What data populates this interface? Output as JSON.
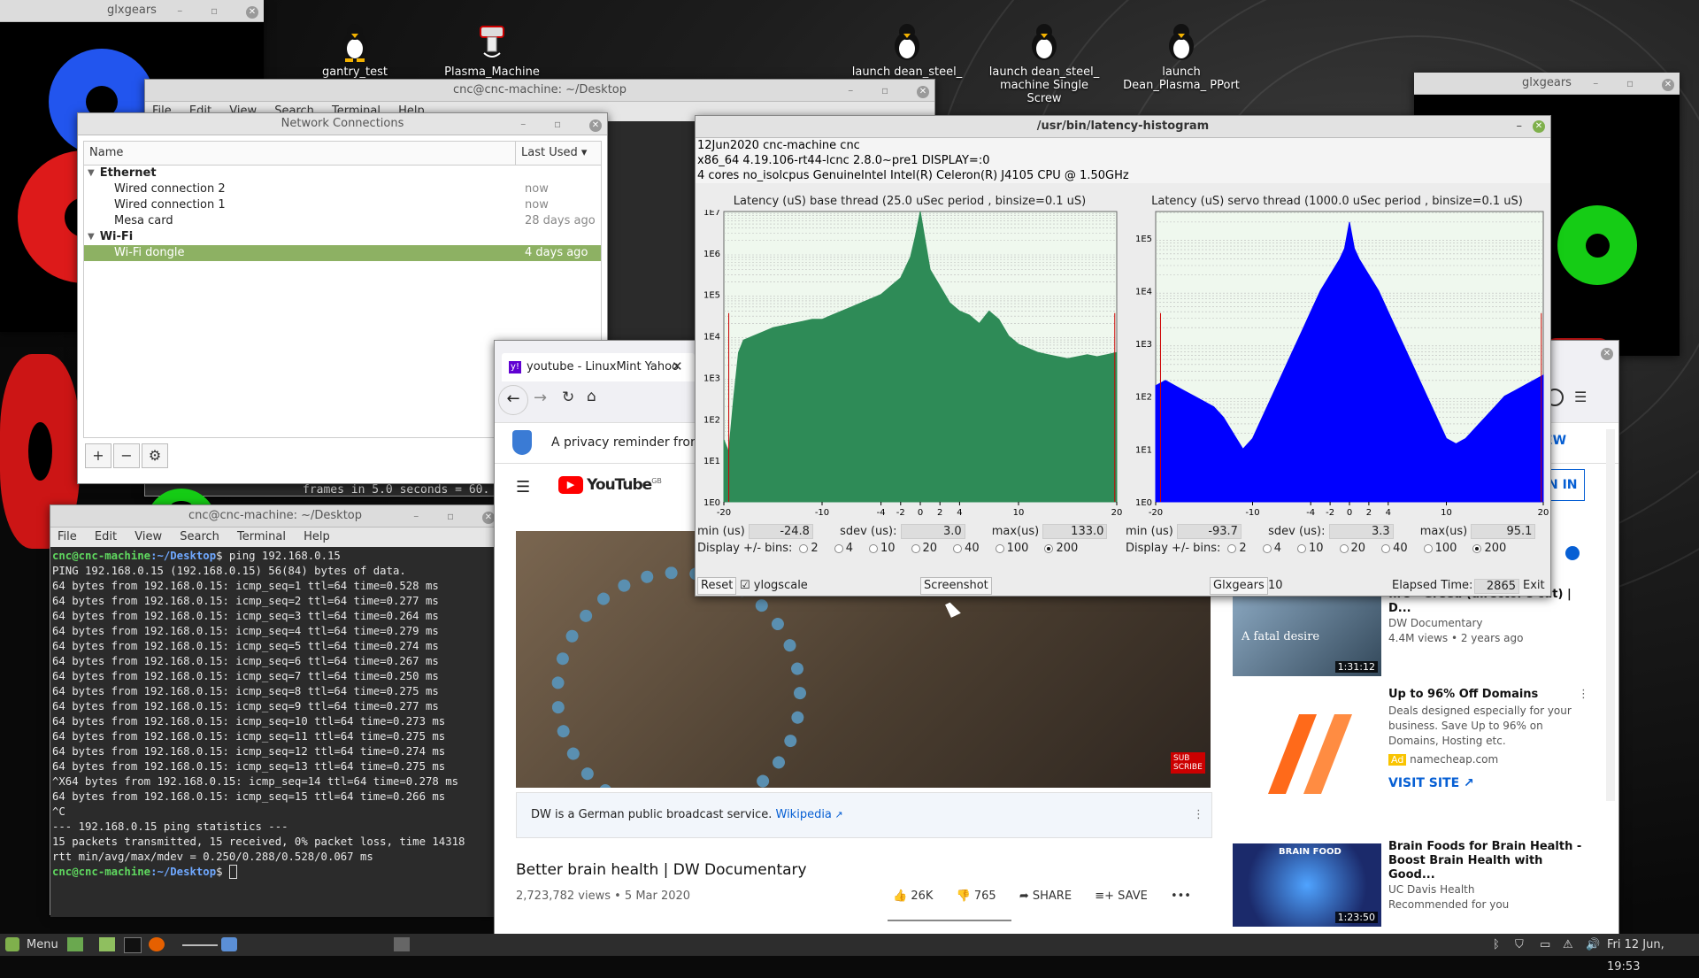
{
  "desktop": {
    "icons": [
      {
        "label": "gantry_test"
      },
      {
        "label": "Plasma_Machine"
      },
      {
        "label": "launch dean_steel_ ... are"
      },
      {
        "label": "launch dean_steel_ machine Single Screw"
      },
      {
        "label": "launch Dean_Plasma_ PPort"
      }
    ]
  },
  "glxgears_left": {
    "title": "glxgears"
  },
  "glxgears_right": {
    "title": "glxgears"
  },
  "back_terminal": {
    "title": "cnc@cnc-machine: ~/Desktop",
    "menu": [
      "File",
      "Edit",
      "View",
      "Search",
      "Terminal",
      "Help"
    ],
    "frames_line": "frames in 5.0 seconds = 60."
  },
  "network": {
    "title": "Network Connections",
    "col_name": "Name",
    "col_used": "Last Used",
    "groups": [
      {
        "name": "Ethernet",
        "items": [
          {
            "name": "Wired connection 2",
            "used": "now"
          },
          {
            "name": "Wired connection 1",
            "used": "now"
          },
          {
            "name": "Mesa card",
            "used": "28 days ago"
          }
        ]
      },
      {
        "name": "Wi-Fi",
        "items": [
          {
            "name": "Wi-Fi dongle",
            "used": "4 days ago"
          }
        ]
      }
    ],
    "buttons": [
      "+",
      "−",
      "⚙"
    ]
  },
  "terminal": {
    "title": "cnc@cnc-machine: ~/Desktop",
    "menu": [
      "File",
      "Edit",
      "View",
      "Search",
      "Terminal",
      "Help"
    ],
    "prompt_user": "cnc@cnc-machine",
    "prompt_path": ":~/Desktop",
    "command": "$ ping 192.168.0.15",
    "lines": [
      "PING 192.168.0.15 (192.168.0.15) 56(84) bytes of data.",
      "64 bytes from 192.168.0.15: icmp_seq=1 ttl=64 time=0.528 ms",
      "64 bytes from 192.168.0.15: icmp_seq=2 ttl=64 time=0.277 ms",
      "64 bytes from 192.168.0.15: icmp_seq=3 ttl=64 time=0.264 ms",
      "64 bytes from 192.168.0.15: icmp_seq=4 ttl=64 time=0.279 ms",
      "64 bytes from 192.168.0.15: icmp_seq=5 ttl=64 time=0.274 ms",
      "64 bytes from 192.168.0.15: icmp_seq=6 ttl=64 time=0.267 ms",
      "64 bytes from 192.168.0.15: icmp_seq=7 ttl=64 time=0.250 ms",
      "64 bytes from 192.168.0.15: icmp_seq=8 ttl=64 time=0.275 ms",
      "64 bytes from 192.168.0.15: icmp_seq=9 ttl=64 time=0.277 ms",
      "64 bytes from 192.168.0.15: icmp_seq=10 ttl=64 time=0.273 ms",
      "64 bytes from 192.168.0.15: icmp_seq=11 ttl=64 time=0.275 ms",
      "64 bytes from 192.168.0.15: icmp_seq=12 ttl=64 time=0.274 ms",
      "64 bytes from 192.168.0.15: icmp_seq=13 ttl=64 time=0.275 ms",
      "^X64 bytes from 192.168.0.15: icmp_seq=14 ttl=64 time=0.278 ms",
      "64 bytes from 192.168.0.15: icmp_seq=15 ttl=64 time=0.266 ms",
      "^C",
      "--- 192.168.0.15 ping statistics ---",
      "15 packets transmitted, 15 received, 0% packet loss, time 14318",
      "rtt min/avg/max/mdev = 0.250/0.288/0.528/0.067 ms"
    ],
    "final_prompt_suffix": "$ "
  },
  "latency": {
    "title": "/usr/bin/latency-histogram",
    "info1": "12Jun2020 cnc-machine cnc",
    "info2": " x86_64  4.19.106-rt44-lcnc  2.8.0~pre1  DISPLAY=:0",
    "info3": " 4 cores  no_isolcpus   GenuineIntel  Intel(R) Celeron(R) J4105 CPU @ 1.50GHz",
    "base": {
      "title": "Latency (uS) base thread (25.0 uSec period , binsize=0.1 uS)",
      "min_label": "min (us)",
      "min": "-24.8",
      "sdev_label": "sdev (us):",
      "sdev": "3.0",
      "max_label": "max(us)",
      "max": "133.0"
    },
    "servo": {
      "title": "Latency (uS) servo thread (1000.0 uSec period , binsize=0.1 uS)",
      "min_label": "min (us)",
      "min": "-93.7",
      "sdev_label": "sdev (us):",
      "sdev": "3.3",
      "max_label": "max(us)",
      "max": "95.1"
    },
    "display_label": "Display +/- bins:",
    "bin_options": [
      "2",
      "4",
      "10",
      "20",
      "40",
      "100",
      "200"
    ],
    "bin_selected": "200",
    "reset": "Reset",
    "ylogscale": "ylogscale",
    "screenshot": "Screenshot",
    "glxgears": "Glxgears",
    "glx_count": "10",
    "elapsed_label": "Elapsed Time:",
    "elapsed": "2865",
    "exit": "Exit"
  },
  "chart_data": [
    {
      "type": "area",
      "title": "Latency (uS) base thread (25.0 uSec period , binsize=0.1 uS)",
      "x_ticks": [
        "-20",
        "-10",
        "-4",
        "-2",
        "0",
        "2",
        "4",
        "10",
        "20"
      ],
      "y_ticks": [
        "1E0",
        "1E1",
        "1E2",
        "1E3",
        "1E4",
        "1E5",
        "1E6",
        "1E7"
      ],
      "ylog": true,
      "xlim": [
        -20,
        20
      ],
      "ylim_exp": [
        0,
        7
      ],
      "color": "#2e8b57",
      "x": [
        -20,
        -19.5,
        -19,
        -18.5,
        -18,
        -17,
        -16,
        -15,
        -14,
        -13,
        -12,
        -11,
        -10,
        -9,
        -8,
        -7,
        -6,
        -5,
        -4,
        -3,
        -2,
        -1,
        -0.5,
        0,
        0.5,
        1,
        2,
        3,
        4,
        5,
        6,
        7,
        8,
        9,
        10,
        11,
        12,
        13,
        14,
        15,
        16,
        17,
        18,
        19,
        20
      ],
      "y_exp": [
        1.5,
        1.2,
        2.5,
        3.6,
        3.9,
        4.0,
        4.1,
        4.2,
        4.25,
        4.3,
        4.35,
        4.4,
        4.4,
        4.5,
        4.6,
        4.7,
        4.8,
        4.9,
        5.0,
        5.2,
        5.4,
        5.9,
        6.4,
        7.0,
        6.3,
        5.6,
        5.2,
        4.8,
        4.6,
        4.5,
        4.3,
        4.6,
        4.4,
        4.0,
        3.8,
        3.7,
        3.6,
        3.55,
        3.5,
        3.45,
        3.5,
        3.55,
        3.5,
        3.55,
        3.6
      ]
    },
    {
      "type": "area",
      "title": "Latency (uS) servo thread (1000.0 uSec period , binsize=0.1 uS)",
      "x_ticks": [
        "-20",
        "-10",
        "-4",
        "-2",
        "0",
        "2",
        "4",
        "10",
        "20"
      ],
      "y_ticks": [
        "1E0",
        "1E1",
        "1E2",
        "1E3",
        "1E4",
        "1E5"
      ],
      "ylog": true,
      "xlim": [
        -20,
        20
      ],
      "ylim_exp": [
        0,
        5.5
      ],
      "color": "#0000ff",
      "x": [
        -20,
        -19,
        -18,
        -17,
        -16,
        -15,
        -14,
        -13,
        -12,
        -11,
        -10,
        -9,
        -8,
        -7,
        -6,
        -5,
        -4,
        -3,
        -2,
        -1,
        -0.5,
        0,
        0.5,
        1,
        2,
        3,
        4,
        5,
        6,
        7,
        8,
        9,
        10,
        11,
        12,
        13,
        14,
        15,
        16,
        17,
        18,
        19,
        20
      ],
      "y_exp": [
        2.2,
        2.3,
        2.2,
        2.1,
        2.0,
        1.9,
        1.8,
        1.6,
        1.3,
        1.0,
        1.2,
        1.6,
        2.0,
        2.4,
        2.8,
        3.2,
        3.6,
        4.0,
        4.3,
        4.6,
        4.8,
        5.3,
        4.8,
        4.6,
        4.3,
        4.0,
        3.6,
        3.2,
        2.8,
        2.4,
        2.0,
        1.6,
        1.2,
        1.1,
        1.2,
        1.4,
        1.6,
        1.8,
        2.0,
        2.1,
        2.2,
        2.3,
        2.4
      ]
    }
  ],
  "browser": {
    "tab_title": "youtube - LinuxMint Yahoo",
    "privacy_text": "A privacy reminder from Y",
    "yt_logo": "YouTube",
    "yt_region": "GB",
    "view_btn": "VIEW",
    "signin_btn": "GN IN",
    "subscribe_badge": "SUB\nSCRIBE",
    "info_text": "DW is a German public broadcast service.",
    "info_link": "Wikipedia",
    "video_title": "Better brain health | DW Documentary",
    "video_meta": "2,723,782 views • 5 Mar 2020",
    "likes": "26K",
    "dislikes": "765",
    "share": "SHARE",
    "save": "SAVE",
    "side": [
      {
        "title": "fire - Greed (director's cut) | D...",
        "channel": "DW Documentary",
        "meta": "4.4M views • 2 years ago",
        "thumb_text": "A fatal desire",
        "duration": "1:31:12"
      },
      {
        "title": "Up to 96% Off Domains",
        "desc": "Deals designed especially for your business. Save Up to 96% on Domains, Hosting etc.",
        "ad": "Ad",
        "channel": "namecheap.com",
        "visit": "VISIT SITE"
      },
      {
        "title": "Brain Foods for Brain Health - Boost Brain Health with Good...",
        "channel": "UC Davis Health",
        "meta": "Recommended for you",
        "thumb_text": "BRAIN FOOD",
        "duration": "1:23:50"
      }
    ]
  },
  "taskbar": {
    "menu": "Menu",
    "clock": "Fri 12 Jun, 19:53"
  }
}
